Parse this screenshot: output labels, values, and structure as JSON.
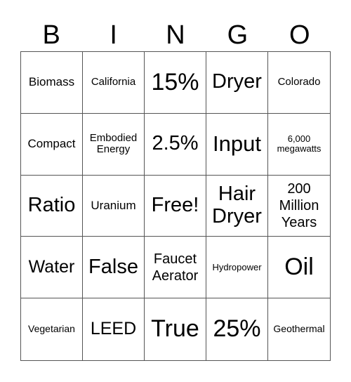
{
  "header": [
    "B",
    "I",
    "N",
    "G",
    "O"
  ],
  "cells": [
    {
      "text": "Biomass",
      "size": "s17"
    },
    {
      "text": "California",
      "size": "s15"
    },
    {
      "text": "15%",
      "size": "s34"
    },
    {
      "text": "Dryer",
      "size": "s29"
    },
    {
      "text": "Colorado",
      "size": "s15"
    },
    {
      "text": "Compact",
      "size": "s17"
    },
    {
      "text": "Embodied Energy",
      "size": "s15"
    },
    {
      "text": "2.5%",
      "size": "s29"
    },
    {
      "text": "Input",
      "size": "s31"
    },
    {
      "text": "6,000 megawatts",
      "size": "s13"
    },
    {
      "text": "Ratio",
      "size": "s29"
    },
    {
      "text": "Uranium",
      "size": "s17"
    },
    {
      "text": "Free!",
      "size": "s29"
    },
    {
      "text": "Hair Dryer",
      "size": "s29"
    },
    {
      "text": "200 Million Years",
      "size": "s20"
    },
    {
      "text": "Water",
      "size": "s25"
    },
    {
      "text": "False",
      "size": "s29"
    },
    {
      "text": "Faucet Aerator",
      "size": "s20"
    },
    {
      "text": "Hydropower",
      "size": "s13"
    },
    {
      "text": "Oil",
      "size": "s34"
    },
    {
      "text": "Vegetarian",
      "size": "s14"
    },
    {
      "text": "LEED",
      "size": "s25"
    },
    {
      "text": "True",
      "size": "s34"
    },
    {
      "text": "25%",
      "size": "s34"
    },
    {
      "text": "Geothermal",
      "size": "s14"
    }
  ]
}
